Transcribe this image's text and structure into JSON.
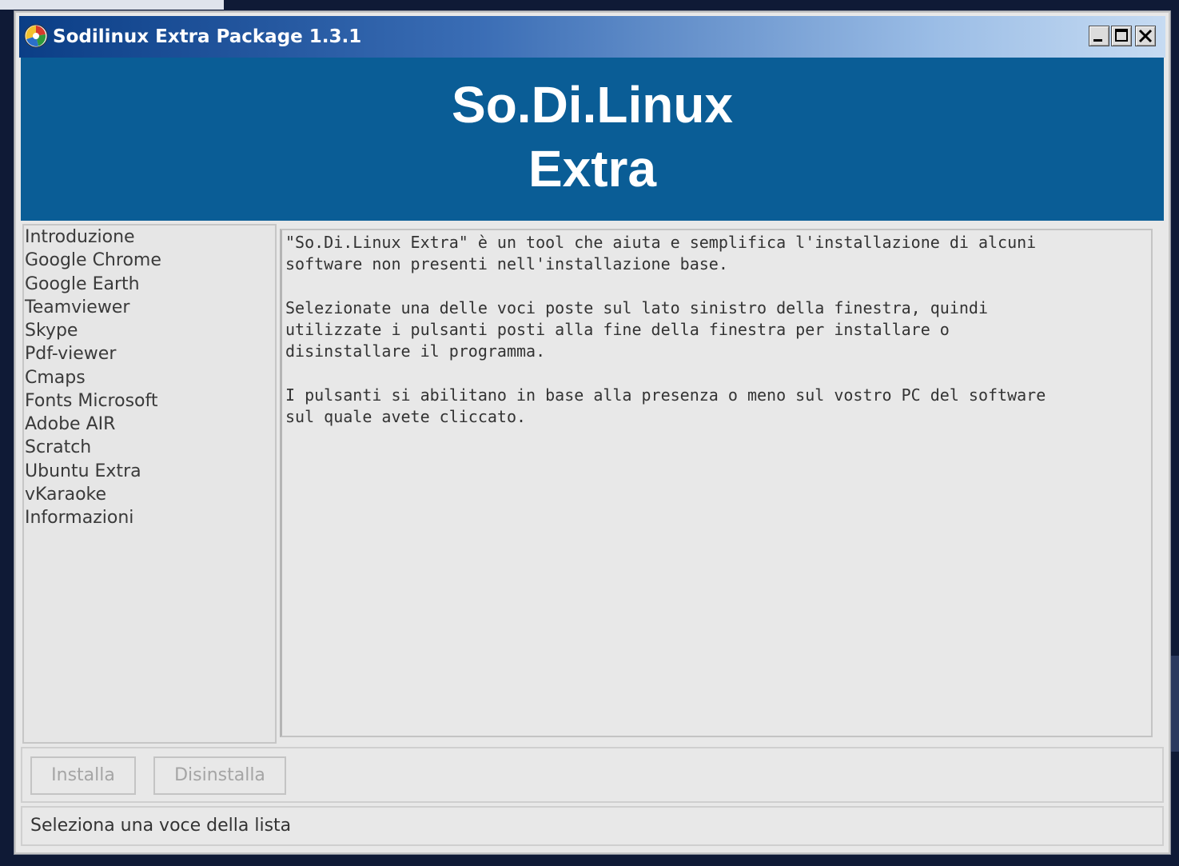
{
  "window": {
    "title": "Sodilinux Extra Package 1.3.1",
    "controls": {
      "minimize_icon": "minimize-icon",
      "maximize_icon": "maximize-icon",
      "close_icon": "close-icon"
    }
  },
  "banner": {
    "line1": "So.Di.Linux",
    "line2": "Extra",
    "background": "#0a5d96"
  },
  "sidebar": {
    "items": [
      {
        "label": "Introduzione"
      },
      {
        "label": "Google Chrome"
      },
      {
        "label": "Google Earth"
      },
      {
        "label": "Teamviewer"
      },
      {
        "label": "Skype"
      },
      {
        "label": "Pdf-viewer"
      },
      {
        "label": "Cmaps"
      },
      {
        "label": "Fonts Microsoft"
      },
      {
        "label": "Adobe AIR"
      },
      {
        "label": "Scratch"
      },
      {
        "label": "Ubuntu Extra"
      },
      {
        "label": "vKaraoke"
      },
      {
        "label": "Informazioni"
      }
    ]
  },
  "content": {
    "paragraphs": [
      "\"So.Di.Linux Extra\" è un tool che aiuta e semplifica l'installazione di alcuni\nsoftware non presenti nell'installazione base.",
      "Selezionate una delle voci poste sul lato sinistro della finestra, quindi\nutilizzate i pulsanti posti alla fine della finestra per installare o\ndisinstallare il programma.",
      "I pulsanti si abilitano in base alla presenza o meno sul vostro PC del software\nsul quale avete cliccato."
    ]
  },
  "buttons": {
    "install_label": "Installa",
    "uninstall_label": "Disinstalla"
  },
  "status": {
    "text": "Seleziona una voce della lista"
  }
}
